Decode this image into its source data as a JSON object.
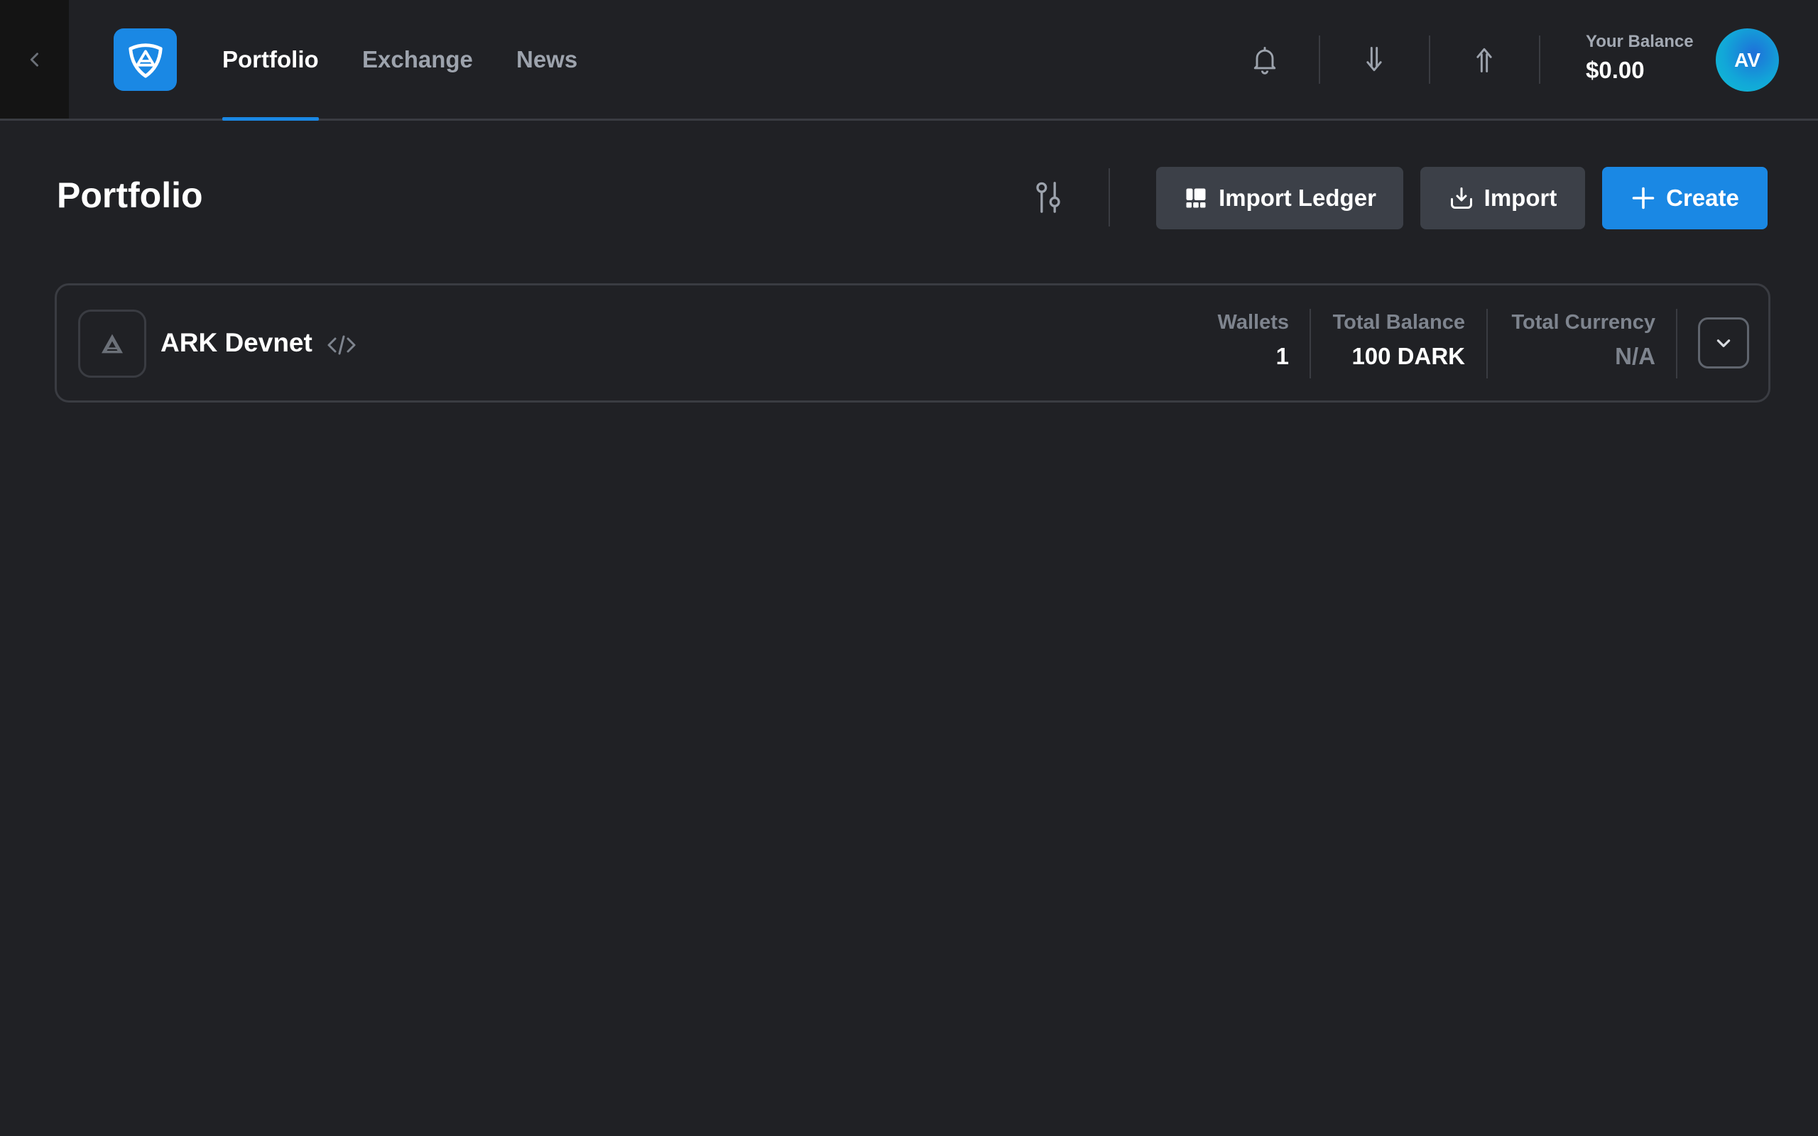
{
  "navbar": {
    "tabs": [
      {
        "label": "Portfolio",
        "active": true
      },
      {
        "label": "Exchange",
        "active": false
      },
      {
        "label": "News",
        "active": false
      }
    ],
    "balance_label": "Your Balance",
    "balance_value": "$0.00",
    "avatar_initials": "AV",
    "icons": [
      "chevron-left-icon",
      "app-logo-icon",
      "bell-icon",
      "receive-arrow-icon",
      "send-arrow-icon"
    ]
  },
  "page": {
    "title": "Portfolio",
    "buttons": {
      "import_ledger": "Import Ledger",
      "import": "Import",
      "create": "Create"
    }
  },
  "network": {
    "name": "ARK Devnet",
    "stats": [
      {
        "label": "Wallets",
        "value": "1"
      },
      {
        "label": "Total Balance",
        "value": "100 DARK"
      },
      {
        "label": "Total Currency",
        "value": "N/A"
      }
    ]
  },
  "colors": {
    "background": "#202125",
    "accent": "#1a88e4",
    "secondary_button": "#3c4048",
    "border": "#3a3c42",
    "muted_text": "#7e848e"
  }
}
